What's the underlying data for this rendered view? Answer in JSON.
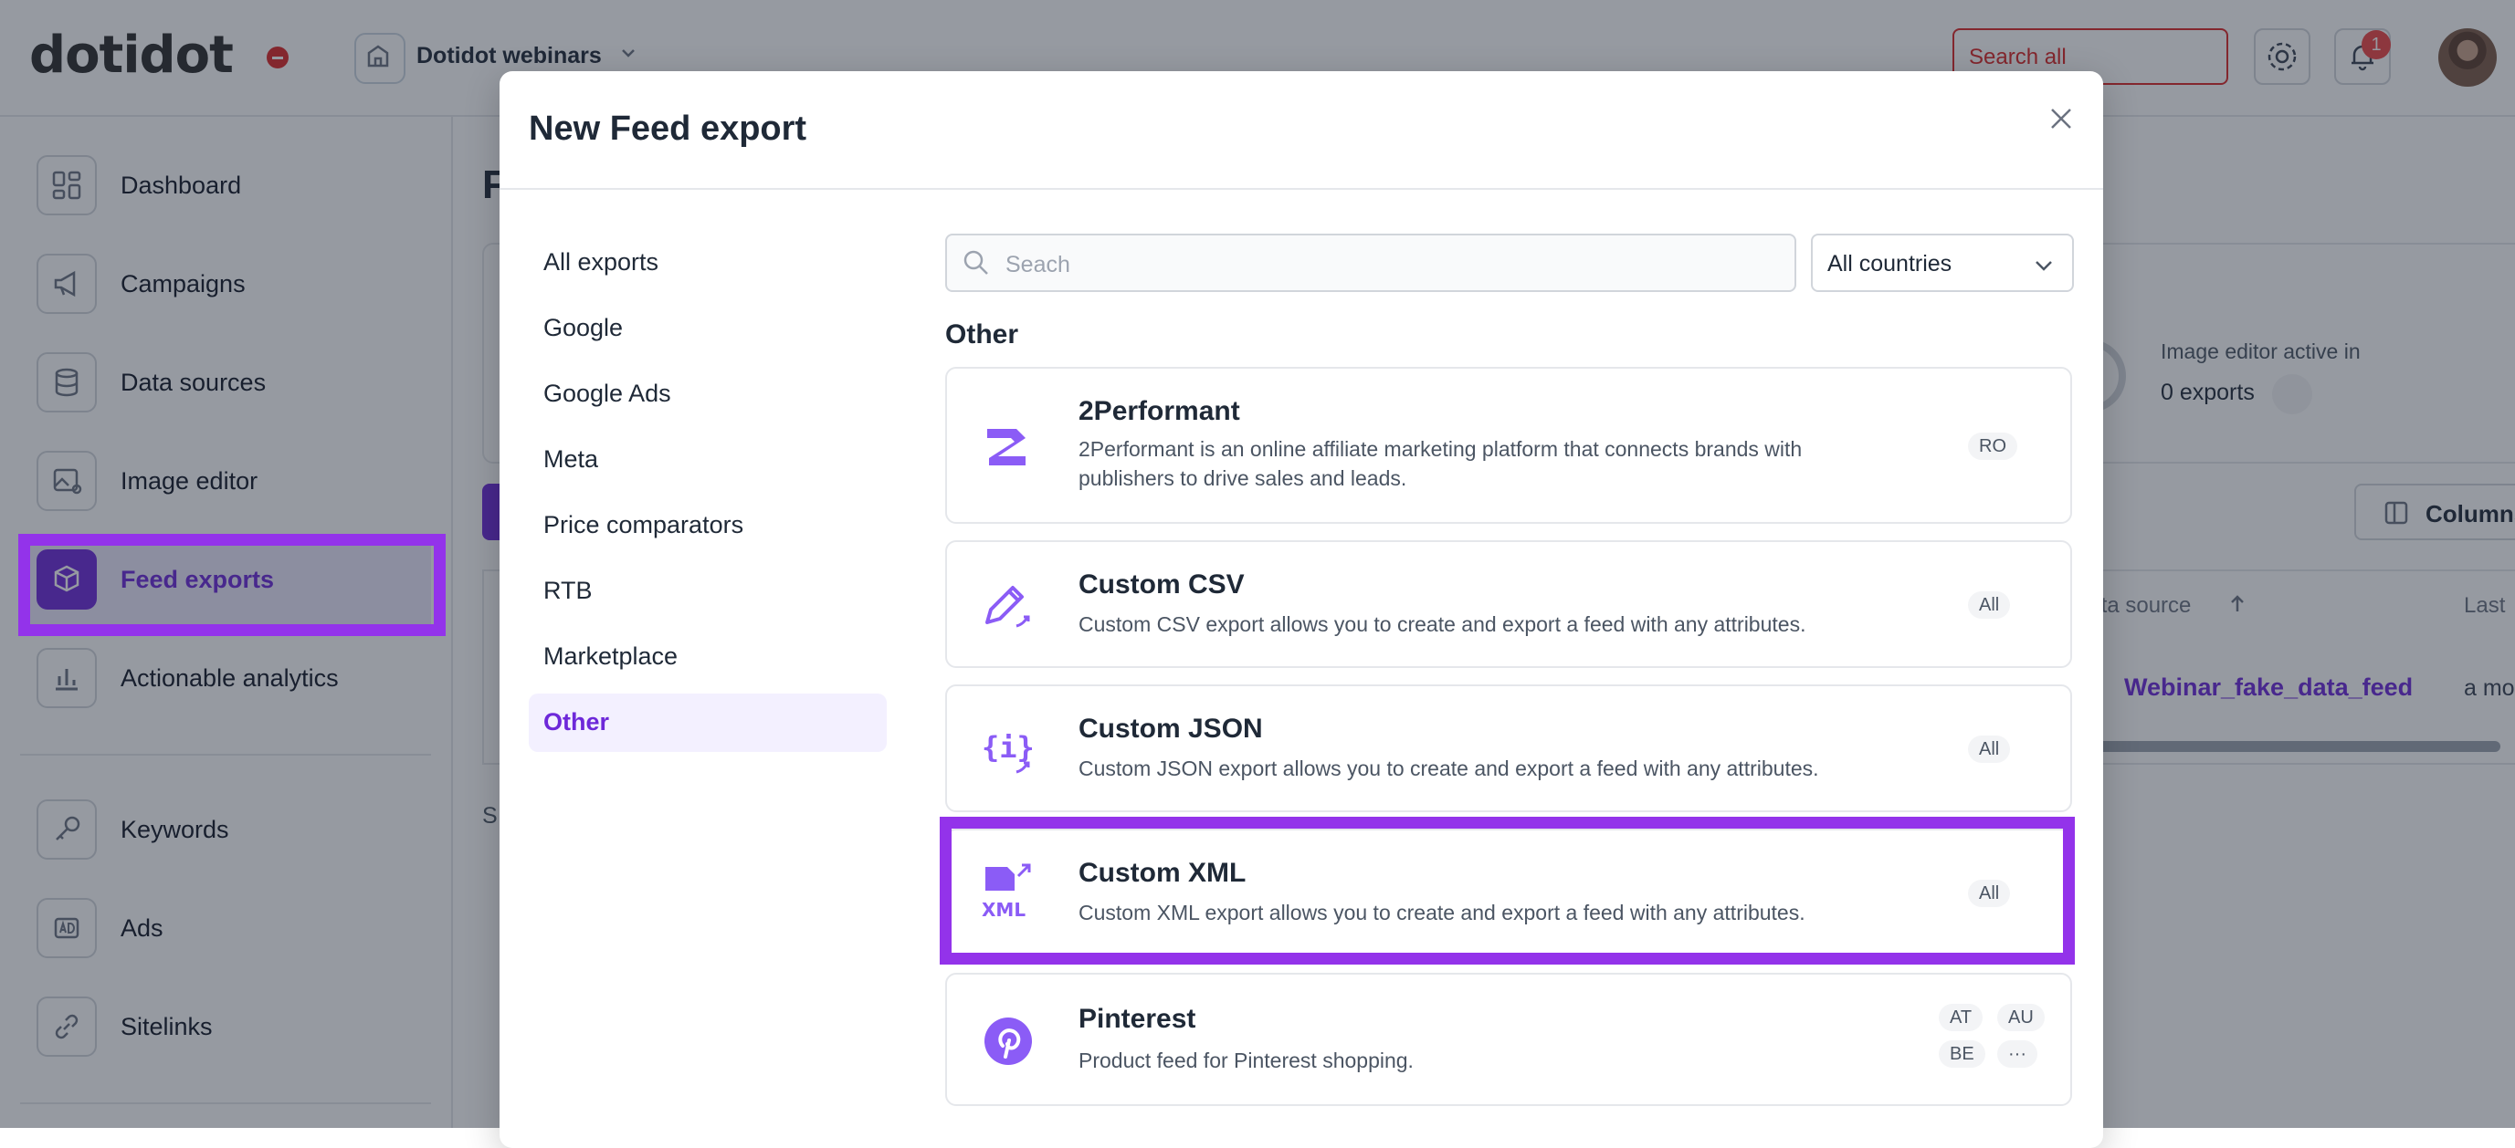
{
  "topbar": {
    "logo": "dotidot",
    "workspace_name": "Dotidot webinars",
    "search_placeholder": "Search all",
    "notification_count": "1"
  },
  "sidebar": {
    "items": [
      {
        "label": "Dashboard"
      },
      {
        "label": "Campaigns"
      },
      {
        "label": "Data sources"
      },
      {
        "label": "Image editor"
      },
      {
        "label": "Feed exports"
      },
      {
        "label": "Actionable analytics"
      },
      {
        "label": "Keywords"
      },
      {
        "label": "Ads"
      },
      {
        "label": "Sitelinks"
      }
    ]
  },
  "background": {
    "page_title_initial": "F",
    "image_editor_label": "Image editor active in",
    "image_editor_value": "0 exports",
    "columns_button": "Columns",
    "col_data_source": "Data source",
    "col_last": "Last",
    "row_data_source": "Webinar_fake_data_feed",
    "row_last": "a mo",
    "footer_initial": "S"
  },
  "modal": {
    "title": "New Feed export",
    "categories": [
      {
        "label": "All exports"
      },
      {
        "label": "Google"
      },
      {
        "label": "Google Ads"
      },
      {
        "label": "Meta"
      },
      {
        "label": "Price comparators"
      },
      {
        "label": "RTB"
      },
      {
        "label": "Marketplace"
      },
      {
        "label": "Other"
      }
    ],
    "search_placeholder": "Seach",
    "country_select": "All countries",
    "section_heading": "Other",
    "exports": [
      {
        "title": "2Performant",
        "description": "2Performant is an online affiliate marketing platform that connects brands with publishers to drive sales and leads.",
        "tags": [
          "RO"
        ]
      },
      {
        "title": "Custom CSV",
        "description": "Custom CSV export allows you to create and export a feed with any attributes.",
        "tags": [
          "All"
        ]
      },
      {
        "title": "Custom JSON",
        "description": "Custom JSON export allows you to create and export a feed with any attributes.",
        "tags": [
          "All"
        ]
      },
      {
        "title": "Custom XML",
        "description": "Custom XML export allows you to create and export a feed with any attributes.",
        "tags": [
          "All"
        ]
      },
      {
        "title": "Pinterest",
        "description": "Product feed for Pinterest shopping.",
        "tags": [
          "AT",
          "AU",
          "BE",
          "···"
        ]
      }
    ]
  },
  "colors": {
    "accent": "#6d28d9",
    "highlight": "#9333ea",
    "danger": "#dc2626"
  }
}
